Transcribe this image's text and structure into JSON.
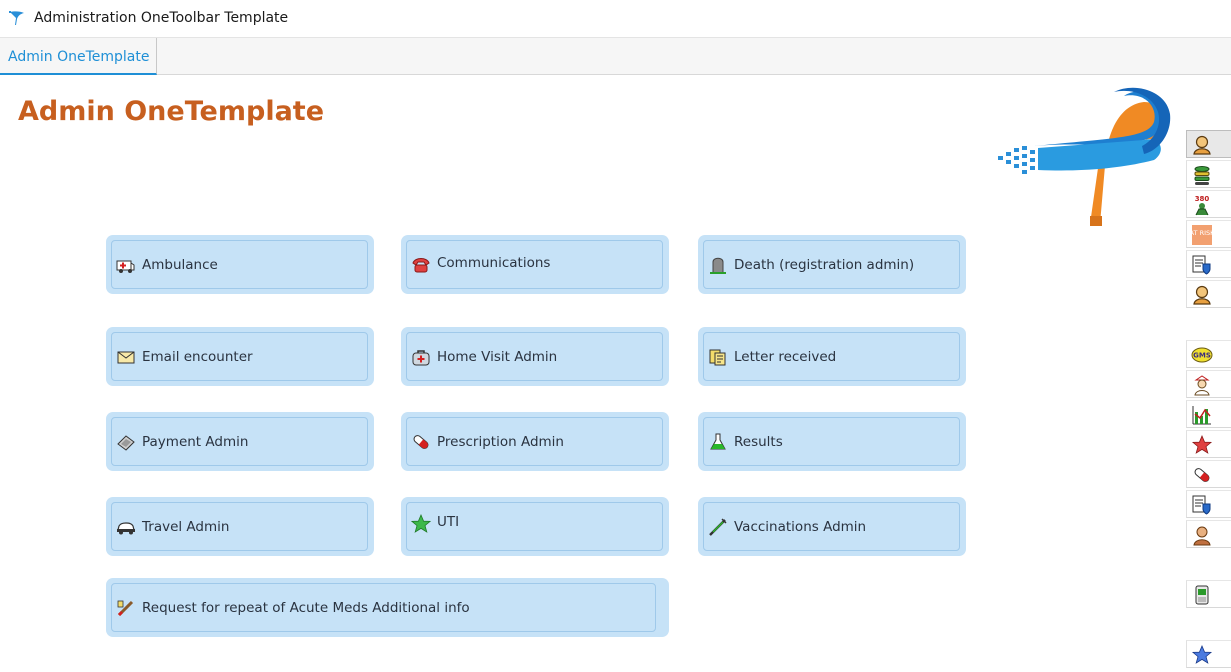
{
  "window": {
    "title": "Administration OneToolbar Template"
  },
  "tabs": [
    {
      "label": "Admin OneTemplate",
      "active": true
    }
  ],
  "page": {
    "title": "Admin OneTemplate"
  },
  "buttons": [
    {
      "label": "Ambulance",
      "icon": "ambulance-icon"
    },
    {
      "label": "Communications",
      "icon": "telephone-icon"
    },
    {
      "label": "Death (registration admin)",
      "icon": "gravestone-icon"
    },
    {
      "label": "Email encounter",
      "icon": "envelope-icon"
    },
    {
      "label": "Home Visit Admin",
      "icon": "medical-bag-icon"
    },
    {
      "label": "Letter received",
      "icon": "letter-icon"
    },
    {
      "label": "Payment Admin",
      "icon": "payment-icon"
    },
    {
      "label": "Prescription Admin",
      "icon": "pill-icon"
    },
    {
      "label": "Results",
      "icon": "flask-icon"
    },
    {
      "label": "Travel Admin",
      "icon": "car-icon"
    },
    {
      "label": "UTI",
      "icon": "star-icon"
    },
    {
      "label": "Vaccinations Admin",
      "icon": "syringe-icon"
    },
    {
      "label": "Request for repeat of Acute Meds Additional info",
      "icon": "pen-icon"
    }
  ],
  "toolbar": {
    "items": [
      {
        "icon": "user-icon"
      },
      {
        "icon": "stack-icon"
      },
      {
        "icon": "thermometer-person-icon",
        "text": "380"
      },
      {
        "icon": "at-risk-icon",
        "text": "AT RISK"
      },
      {
        "icon": "document-shield-icon"
      },
      {
        "icon": "user-icon"
      },
      {
        "icon": "gms-badge-icon",
        "text": "GMS"
      },
      {
        "icon": "nurse-icon"
      },
      {
        "icon": "bar-chart-icon"
      },
      {
        "icon": "red-star-icon"
      },
      {
        "icon": "pill-icon"
      },
      {
        "icon": "document-shield-icon"
      },
      {
        "icon": "person-icon"
      },
      {
        "icon": "phone-device-icon"
      },
      {
        "icon": "blue-star-icon"
      }
    ]
  },
  "colors": {
    "accent": "#1e8fd6",
    "title": "#c75f1f",
    "button_bg": "#c6e2f7",
    "button_border": "#9fc9ea"
  }
}
